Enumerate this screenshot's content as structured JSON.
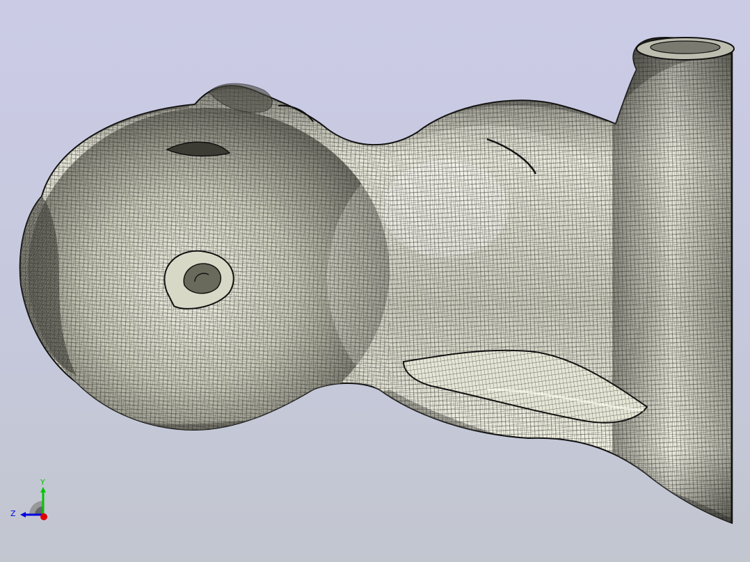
{
  "viewer": {
    "background_top": "#cbcbe6",
    "background_bottom": "#c2c6cf",
    "model": {
      "name": "meshed-figure-model",
      "display_mode": "shaded-with-mesh-edges",
      "surface_color": "#d8d8c8",
      "edge_color": "#1a1a1a"
    },
    "axis_triad": {
      "labels": {
        "y": "Y",
        "z": "Z"
      },
      "colors": {
        "x": "#e00000",
        "y": "#00c800",
        "z": "#0000e0"
      }
    }
  }
}
